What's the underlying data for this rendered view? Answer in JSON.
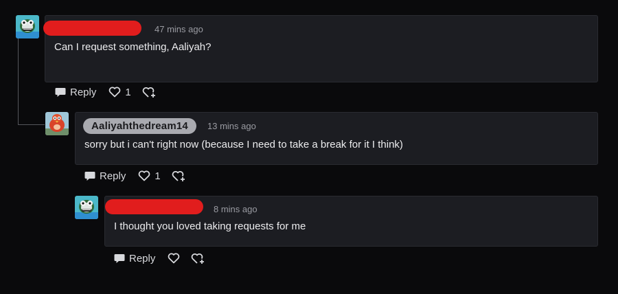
{
  "comments": [
    {
      "username": "",
      "username_redacted": true,
      "time": "47 mins ago",
      "text": "Can I request something, Aaliyah?",
      "reply_label": "Reply",
      "likes": "1"
    },
    {
      "username": "Aaliyahthedream14",
      "username_redacted": false,
      "time": "13 mins ago",
      "text": "sorry but i can't right now (because I need to take a break for it I think)",
      "reply_label": "Reply",
      "likes": "1"
    },
    {
      "username": "",
      "username_redacted": true,
      "time": "8 mins ago",
      "text": "I thought you loved taking requests for me",
      "reply_label": "Reply",
      "likes": ""
    }
  ],
  "icons": {
    "reply": "speech-bubble-icon",
    "like": "heart-icon",
    "add_reaction": "heart-plus-icon"
  },
  "colors": {
    "background": "#0a0a0c",
    "card": "#1c1d22",
    "redaction": "#e11d1d",
    "username_pill": "#a9aab0",
    "timestamp": "#9a9ba2"
  }
}
